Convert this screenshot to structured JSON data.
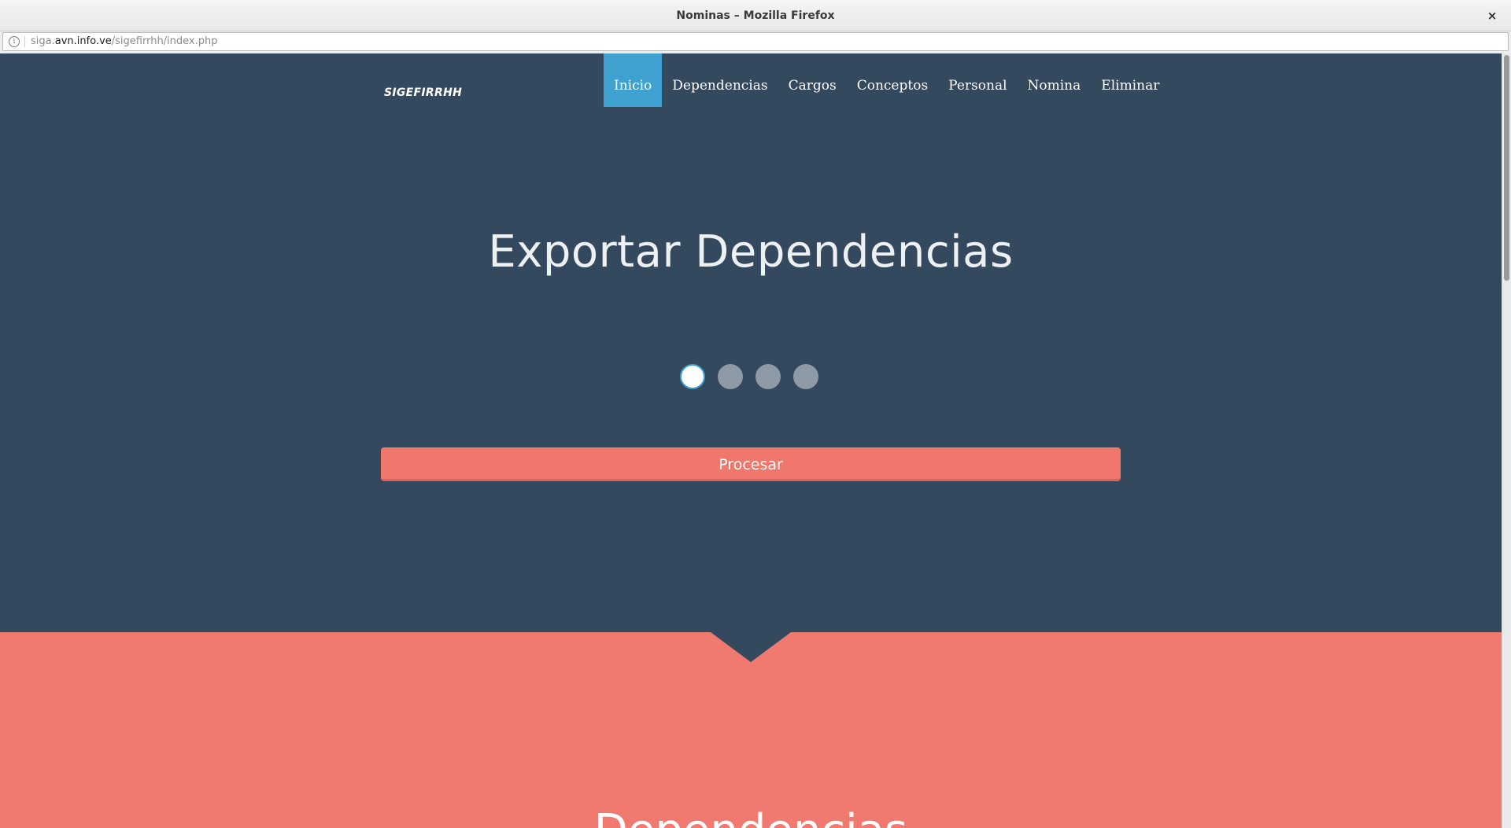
{
  "window": {
    "title": "Nominas – Mozilla Firefox",
    "close_glyph": "×"
  },
  "urlbar": {
    "prefix": "siga.",
    "domain": "avn.info.ve",
    "path": "/sigefirrhh/index.php",
    "info_glyph": "i"
  },
  "nav": {
    "brand": "SIGEFIRRHH",
    "items": [
      {
        "label": "Inicio",
        "active": true
      },
      {
        "label": "Dependencias",
        "active": false
      },
      {
        "label": "Cargos",
        "active": false
      },
      {
        "label": "Conceptos",
        "active": false
      },
      {
        "label": "Personal",
        "active": false
      },
      {
        "label": "Nomina",
        "active": false
      },
      {
        "label": "Eliminar",
        "active": false
      }
    ]
  },
  "hero": {
    "title": "Exportar Dependencias",
    "slides_active_index": 0,
    "button_label": "Procesar"
  },
  "next_section": {
    "title": "Dependencias"
  },
  "colors": {
    "hero_bg": "#34495e",
    "accent_blue": "#3fa1cf",
    "coral": "#f07a6f"
  }
}
